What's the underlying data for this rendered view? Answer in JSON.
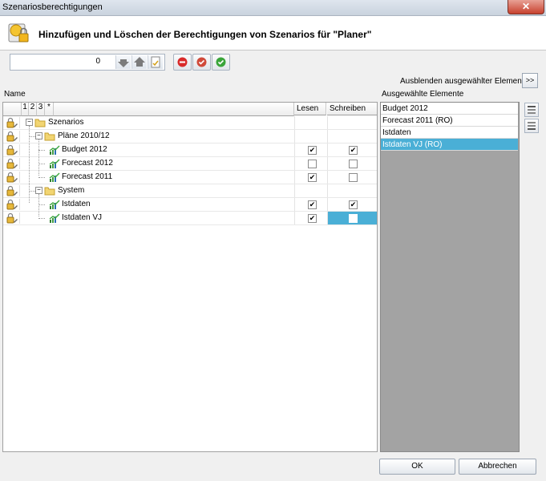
{
  "window": {
    "title": "Szenariosberechtigungen",
    "close_label": "✕"
  },
  "header": {
    "title": "Hinzufügen und Löschen der Berechtigungen von Szenarios für \"Planer\""
  },
  "toolbar": {
    "spin_value": "0"
  },
  "panel": {
    "hide_label": "Ausblenden ausgewählter Elemente",
    "hide_button": ">>",
    "name_label": "Name",
    "selected_label": "Ausgewählte Elemente"
  },
  "grid": {
    "levels": [
      "1",
      "2",
      "3",
      "*"
    ],
    "col_read": "Lesen",
    "col_write": "Schreiben",
    "rows": [
      {
        "label": "Szenarios",
        "type": "folder"
      },
      {
        "label": "Pläne 2010/12",
        "type": "folder"
      },
      {
        "label": "Budget 2012",
        "type": "scenario",
        "read": true,
        "write": true
      },
      {
        "label": "Forecast 2012",
        "type": "scenario",
        "read": false,
        "write": false
      },
      {
        "label": "Forecast 2011",
        "type": "scenario",
        "read": true,
        "write": false
      },
      {
        "label": "System",
        "type": "folder"
      },
      {
        "label": "Istdaten",
        "type": "scenario",
        "read": true,
        "write": true
      },
      {
        "label": "Istdaten VJ",
        "type": "scenario",
        "read": true,
        "write": false,
        "selected_cell": true
      }
    ]
  },
  "selected_items": [
    "Budget 2012",
    "Forecast 2011 (RO)",
    "Istdaten",
    "Istdaten VJ (RO)"
  ],
  "buttons": {
    "ok": "OK",
    "cancel": "Abbrechen"
  },
  "colors": {
    "selection": "#4aafd6",
    "list_bg": "#a3a3a3"
  }
}
